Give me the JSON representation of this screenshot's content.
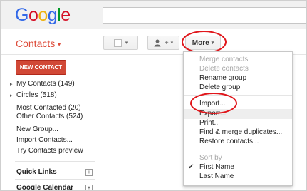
{
  "logo": {
    "letters": [
      "G",
      "o",
      "o",
      "g",
      "l",
      "e"
    ]
  },
  "search": {
    "value": ""
  },
  "header": {
    "title": "Contacts",
    "title_caret": "▾"
  },
  "toolbar": {
    "more_label": "More",
    "caret": "▾",
    "add_person_glyph": "+"
  },
  "sidebar": {
    "new_contact_label": "NEW CONTACT",
    "groups": [
      {
        "label": "My Contacts (149)",
        "expander": "▸"
      },
      {
        "label": "Circles (518)",
        "expander": "▸"
      }
    ],
    "links": [
      "Most Contacted (20)",
      "Other Contacts (524)"
    ],
    "actions": [
      "New Group...",
      "Import Contacts...",
      "Try Contacts preview"
    ],
    "sections": [
      {
        "label": "Quick Links",
        "toggle": "+"
      },
      {
        "label": "Google Calendar",
        "toggle": "+"
      }
    ]
  },
  "more_menu": {
    "items": [
      {
        "label": "Merge contacts",
        "enabled": false
      },
      {
        "label": "Delete contacts",
        "enabled": false
      },
      {
        "label": "Rename group",
        "enabled": true
      },
      {
        "label": "Delete group",
        "enabled": true
      },
      {
        "label": "Import...",
        "enabled": true
      },
      {
        "label": "Export...",
        "enabled": true,
        "hovered": true
      },
      {
        "label": "Print...",
        "enabled": true
      },
      {
        "label": "Find & merge duplicates...",
        "enabled": true
      },
      {
        "label": "Restore contacts...",
        "enabled": true
      }
    ],
    "sort_header": "Sort by",
    "sort_options": [
      {
        "label": "First Name",
        "selected": true
      },
      {
        "label": "Last Name",
        "selected": false
      }
    ],
    "check_glyph": "✔"
  },
  "annotations": {
    "highlight_color": "#e0161b"
  }
}
